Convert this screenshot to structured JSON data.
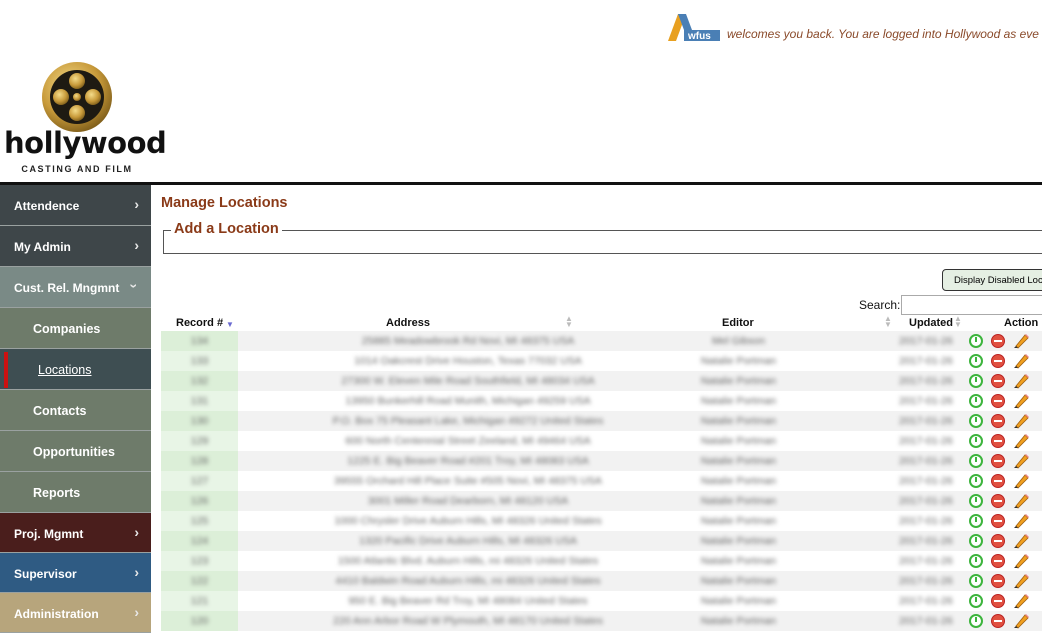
{
  "header": {
    "wfus_logo_text": "wfus",
    "welcome": "welcomes you back. You are logged into Hollywood as eve"
  },
  "brand": {
    "name": "hollywood",
    "tagline": "CASTING AND FILM"
  },
  "sidebar": {
    "items": [
      {
        "label": "Attendence"
      },
      {
        "label": "My Admin"
      },
      {
        "label": "Cust. Rel. Mngmnt"
      },
      {
        "label": "Companies"
      },
      {
        "label": "Locations"
      },
      {
        "label": "Contacts"
      },
      {
        "label": "Opportunities"
      },
      {
        "label": "Reports"
      },
      {
        "label": "Proj. Mgmnt"
      },
      {
        "label": "Supervisor"
      },
      {
        "label": "Administration"
      }
    ]
  },
  "main": {
    "title": "Manage Locations",
    "add_legend": "Add a Location",
    "display_disabled_button": "Display Disabled Locations",
    "search_label": "Search:",
    "search_value": "",
    "columns": [
      "Record #",
      "Address",
      "Editor",
      "Updated",
      "Action"
    ],
    "rows": [
      {
        "rec": "134",
        "addr": "25885 Meadowbrook Rd Novi, MI 48375 USA",
        "editor": "Mel Gibson",
        "updated": "2017-01-26"
      },
      {
        "rec": "133",
        "addr": "1014 Oakcrest Drive Houston, Texas 77032 USA",
        "editor": "Natalie Portman",
        "updated": "2017-01-26"
      },
      {
        "rec": "132",
        "addr": "27300 W. Eleven Mile Road Southfield, MI 48034 USA",
        "editor": "Natalie Portman",
        "updated": "2017-01-26"
      },
      {
        "rec": "131",
        "addr": "13950 Bunkerhill Road Munith, Michigan 49259 USA",
        "editor": "Natalie Portman",
        "updated": "2017-01-26"
      },
      {
        "rec": "130",
        "addr": "P.O. Box 75 Pleasant Lake, Michigan 49272 United States",
        "editor": "Natalie Portman",
        "updated": "2017-01-26"
      },
      {
        "rec": "129",
        "addr": "600 North Centennial Street Zeeland, MI 49464 USA",
        "editor": "Natalie Portman",
        "updated": "2017-01-26"
      },
      {
        "rec": "128",
        "addr": "1225 E. Big Beaver Road #201 Troy, MI 48083 USA",
        "editor": "Natalie Portman",
        "updated": "2017-01-26"
      },
      {
        "rec": "127",
        "addr": "39555 Orchard Hill Place Suite #505 Novi, MI 48375 USA",
        "editor": "Natalie Portman",
        "updated": "2017-01-26"
      },
      {
        "rec": "126",
        "addr": "3001 Miller Road Dearborn, MI 48120 USA",
        "editor": "Natalie Portman",
        "updated": "2017-01-26"
      },
      {
        "rec": "125",
        "addr": "1000 Chrysler Drive Auburn Hills, MI 48326 United States",
        "editor": "Natalie Portman",
        "updated": "2017-01-26"
      },
      {
        "rec": "124",
        "addr": "1320 Pacific Drive Auburn Hills, MI 48326 USA",
        "editor": "Natalie Portman",
        "updated": "2017-01-26"
      },
      {
        "rec": "123",
        "addr": "1500 Atlantic Blvd. Auburn Hills, mi 48326 United States",
        "editor": "Natalie Portman",
        "updated": "2017-01-26"
      },
      {
        "rec": "122",
        "addr": "4410 Baldwin Road Auburn Hills, mi 48326 United States",
        "editor": "Natalie Portman",
        "updated": "2017-01-26"
      },
      {
        "rec": "121",
        "addr": "950 E. Big Beaver Rd Troy, MI 48084 United States",
        "editor": "Natalie Portman",
        "updated": "2017-01-26"
      },
      {
        "rec": "120",
        "addr": "220 Ann Arbor Road W Plymouth, MI 48170 United States",
        "editor": "Natalie Portman",
        "updated": "2017-01-26"
      }
    ]
  },
  "colors": {
    "accent": "#8a3a18",
    "active_marker": "#cc1111"
  }
}
